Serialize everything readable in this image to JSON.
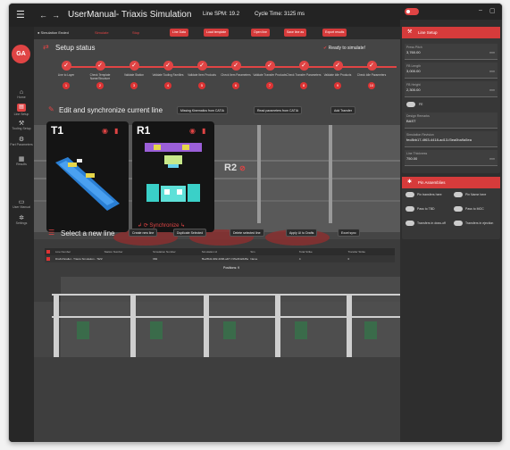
{
  "window": {
    "title": "UserManual- Triaxis Simulation",
    "spm": "Line SPM: 19.2",
    "cycle": "Cycle Time: 3125 ms"
  },
  "rail": {
    "logo": "GA",
    "items": [
      {
        "label": "Home",
        "icon": "home-icon"
      },
      {
        "label": "Line Setup",
        "icon": "factory-icon"
      },
      {
        "label": "Tooling Setup",
        "icon": "tool-icon"
      },
      {
        "label": "Part Parameters",
        "icon": "part-icon"
      },
      {
        "label": "Results",
        "icon": "chart-icon"
      },
      {
        "label": "User Manual",
        "icon": "book-icon"
      },
      {
        "label": "Settings",
        "icon": "gear-icon"
      }
    ]
  },
  "toolbar": {
    "status": "● Simulation Ended",
    "label_a": "Simulate",
    "label_b": "Stop",
    "buttons": [
      "Line Data",
      "Load template",
      "Open line",
      "Save line as",
      "Export results"
    ]
  },
  "setup": {
    "title": "Setup status",
    "ready": "Ready to simulate!",
    "steps": [
      {
        "label": "Line to Layer",
        "badge": "1"
      },
      {
        "label": "Check Template Name/Structure",
        "badge": "2"
      },
      {
        "label": "Validate Station",
        "badge": "3"
      },
      {
        "label": "Validate Tooling Families",
        "badge": "4"
      },
      {
        "label": "Validate Item Products",
        "badge": "5"
      },
      {
        "label": "Check Item Parameters",
        "badge": "6"
      },
      {
        "label": "Validate Transfer Products",
        "badge": "7"
      },
      {
        "label": "Check Transfer Parameters",
        "badge": "8"
      },
      {
        "label": "Validate Idle Products",
        "badge": "9"
      },
      {
        "label": "Check Idle Parameters",
        "badge": "10"
      }
    ]
  },
  "edit": {
    "title": "Edit and synchronize current line",
    "buttons": [
      "Missing Kinematics from CATIA",
      "Read parameters from CATIA",
      "Add Transfer"
    ]
  },
  "cards": [
    {
      "name": "T1"
    },
    {
      "name": "R1",
      "sync": "Synchronize"
    }
  ],
  "r2": {
    "name": "R2"
  },
  "select": {
    "title": "Select a new line",
    "buttons": [
      "Create new line",
      "Duplicate Selected",
      "Delete selected line",
      "Apply UI to Drafts",
      "Excel sync"
    ]
  },
  "table": {
    "headers": [
      "Line Number",
      "Station Number",
      "Simulation Number",
      "Simulation id",
      "Sim",
      "Total Strike",
      "Transfer Strike"
    ],
    "row": [
      "Draft-Parallel - Triaxis Simulation - TEST",
      "",
      "984",
      "f5e2f6d1-982-4b68-a4f7-7d5e6f4a5d5a",
      "Name",
      "4",
      "0"
    ],
    "positions": "Positions: 9"
  },
  "panel": {
    "line_setup": "Line Setup",
    "fields": [
      {
        "label": "Press Pitch",
        "value": "3,760.00",
        "unit": "mm"
      },
      {
        "label": "FB Length",
        "value": "3,000.00",
        "unit": "mm"
      },
      {
        "label": "FB Height",
        "value": "2,300.00",
        "unit": "mm"
      }
    ],
    "toggle_label": "FE",
    "fields2": [
      {
        "label": "Design Remarks",
        "value": "BAST"
      },
      {
        "label": "Simulation Revision",
        "value": "fec8bb17-4f63-4418-ad13-f3ea0ba9a5ea"
      },
      {
        "label": "Line Thickness",
        "value": "750.00",
        "unit": "mm"
      }
    ],
    "ras_title": "Pin Assemblies",
    "ras": [
      "Pin transfers here",
      "Pin Name here",
      "Pass to TBD",
      "Pass to MOC",
      "Transfers in draw-off",
      "Transfers in ejection"
    ]
  },
  "colors": {
    "accent": "#d63b3b",
    "bg": "#404040"
  }
}
